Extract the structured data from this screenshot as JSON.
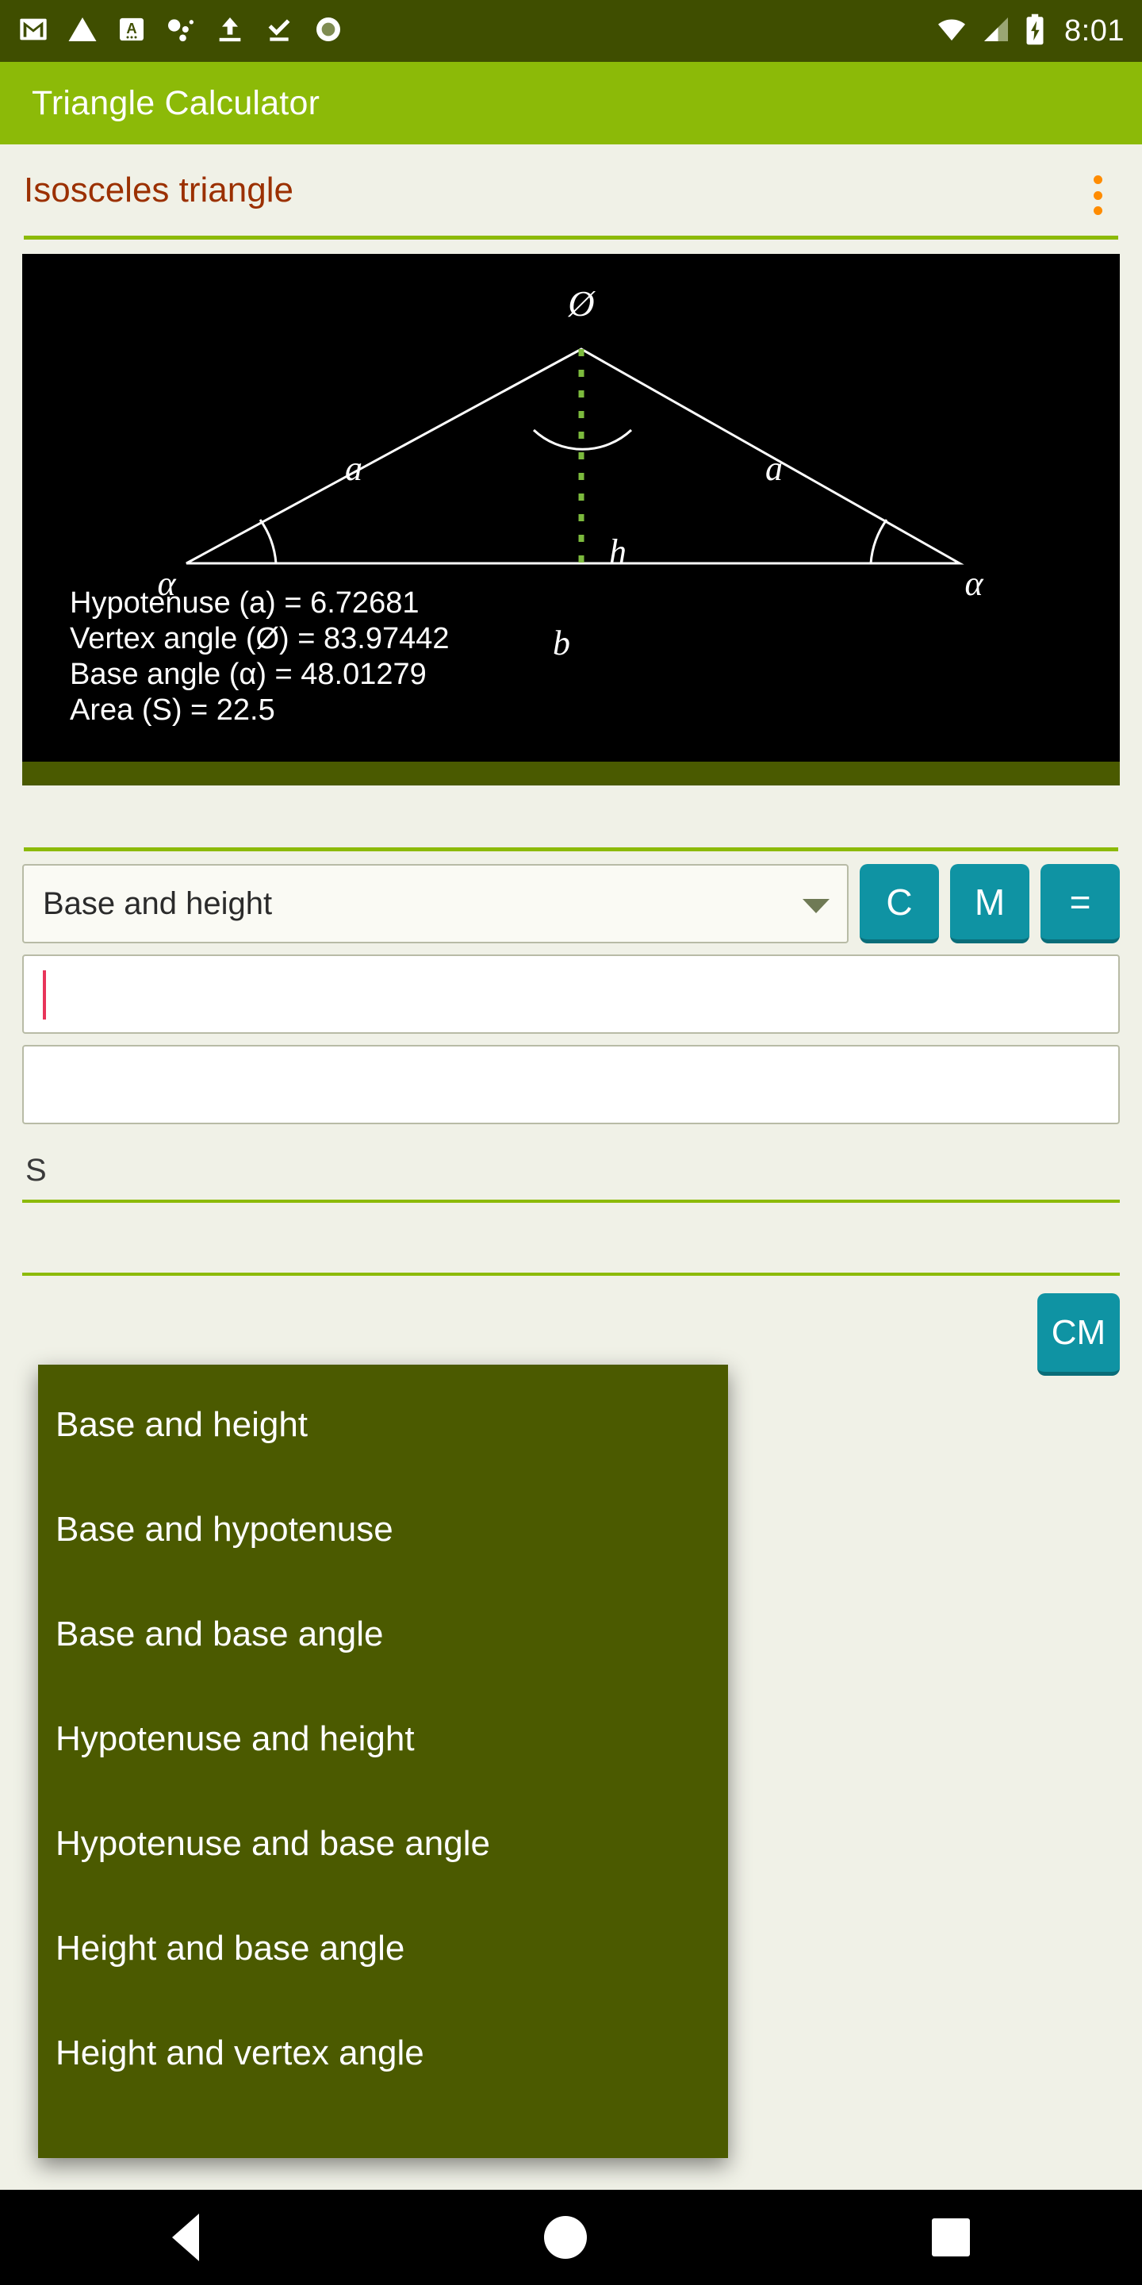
{
  "status_bar": {
    "time": "8:01",
    "left_icons": [
      "gmail-icon",
      "warning-icon",
      "screenshot-icon",
      "bluetooth-dots-icon",
      "upload-icon",
      "download-check-icon",
      "record-icon"
    ],
    "right_icons": [
      "wifi-icon",
      "cell-signal-icon",
      "battery-charging-icon"
    ],
    "background": "#3f4e00"
  },
  "app_bar": {
    "title": "Triangle Calculator",
    "background": "#8cba08"
  },
  "section": {
    "title": "Isosceles triangle",
    "title_color": "#9b3000",
    "overflow_menu": "more-options"
  },
  "diagram": {
    "background": "#000000",
    "stroke": "#ffffff",
    "height_line_color": "#7cba3d",
    "labels": {
      "vertex": "Ø",
      "left_side": "a",
      "right_side": "a",
      "height": "h",
      "base": "b",
      "left_angle": "α",
      "right_angle": "α"
    },
    "results": [
      "Hypotenuse (a) = 6.72681",
      "Vertex angle (Ø) = 83.97442",
      "Base angle (α) = 48.01279",
      "Area (S) = 22.5"
    ]
  },
  "form": {
    "mode_spinner_value": "Base and height",
    "buttons": {
      "clear": "C",
      "memory": "M",
      "equals": "="
    },
    "field_base_value": "",
    "field_height_value": "",
    "result_label": "S",
    "unit_button": "CM"
  },
  "dropdown": {
    "background": "#4b5a00",
    "items": [
      "Base and height",
      "Base and hypotenuse",
      "Base and base angle",
      "Hypotenuse and height",
      "Hypotenuse and base angle",
      "Height and base angle",
      "Height and vertex angle"
    ]
  },
  "nav_bar": {
    "back": "back-icon",
    "home": "home-icon",
    "recents": "recents-icon"
  },
  "colors": {
    "accent_green": "#8cba08",
    "dark_green": "#3f4e00",
    "teal": "#0f93a3",
    "orange": "#ff8c00",
    "page_bg": "#f0f1e7"
  }
}
